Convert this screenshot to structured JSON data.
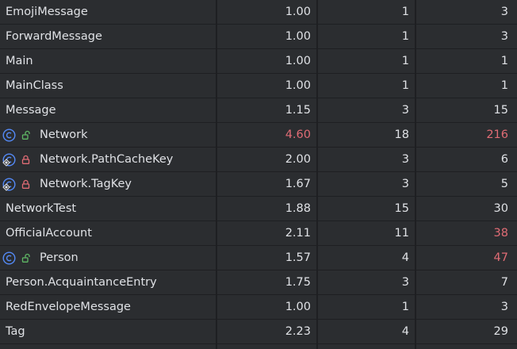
{
  "colors": {
    "background": "#2b2d30",
    "text": "#dfe1e5",
    "warning": "#e06c75",
    "class_icon": "#548af7",
    "unlocked_icon": "#5fb865",
    "locked_icon": "#e06c75"
  },
  "rows": [
    {
      "name": "EmojiMessage",
      "a": "1.00",
      "b": "1",
      "c": "3",
      "icon": "",
      "lock": "",
      "a_warn": false,
      "c_warn": false
    },
    {
      "name": "ForwardMessage",
      "a": "1.00",
      "b": "1",
      "c": "3",
      "icon": "",
      "lock": "",
      "a_warn": false,
      "c_warn": false
    },
    {
      "name": "Main",
      "a": "1.00",
      "b": "1",
      "c": "1",
      "icon": "",
      "lock": "",
      "a_warn": false,
      "c_warn": false
    },
    {
      "name": "MainClass",
      "a": "1.00",
      "b": "1",
      "c": "1",
      "icon": "",
      "lock": "",
      "a_warn": false,
      "c_warn": false
    },
    {
      "name": "Message",
      "a": "1.15",
      "b": "3",
      "c": "15",
      "icon": "",
      "lock": "",
      "a_warn": false,
      "c_warn": false
    },
    {
      "name": "Network",
      "a": "4.60",
      "b": "18",
      "c": "216",
      "icon": "class-icon",
      "lock": "unlocked-icon",
      "a_warn": true,
      "c_warn": true
    },
    {
      "name": "Network.PathCacheKey",
      "a": "2.00",
      "b": "3",
      "c": "6",
      "icon": "inner-class-icon",
      "lock": "locked-icon",
      "a_warn": false,
      "c_warn": false
    },
    {
      "name": "Network.TagKey",
      "a": "1.67",
      "b": "3",
      "c": "5",
      "icon": "inner-class-icon",
      "lock": "locked-icon",
      "a_warn": false,
      "c_warn": false
    },
    {
      "name": "NetworkTest",
      "a": "1.88",
      "b": "15",
      "c": "30",
      "icon": "",
      "lock": "",
      "a_warn": false,
      "c_warn": false
    },
    {
      "name": "OfficialAccount",
      "a": "2.11",
      "b": "11",
      "c": "38",
      "icon": "",
      "lock": "",
      "a_warn": false,
      "c_warn": true
    },
    {
      "name": "Person",
      "a": "1.57",
      "b": "4",
      "c": "47",
      "icon": "class-icon",
      "lock": "unlocked-icon",
      "a_warn": false,
      "c_warn": true
    },
    {
      "name": "Person.AcquaintanceEntry",
      "a": "1.75",
      "b": "3",
      "c": "7",
      "icon": "",
      "lock": "",
      "a_warn": false,
      "c_warn": false
    },
    {
      "name": "RedEnvelopeMessage",
      "a": "1.00",
      "b": "1",
      "c": "3",
      "icon": "",
      "lock": "",
      "a_warn": false,
      "c_warn": false
    },
    {
      "name": "Tag",
      "a": "2.23",
      "b": "4",
      "c": "29",
      "icon": "",
      "lock": "",
      "a_warn": false,
      "c_warn": false
    }
  ]
}
